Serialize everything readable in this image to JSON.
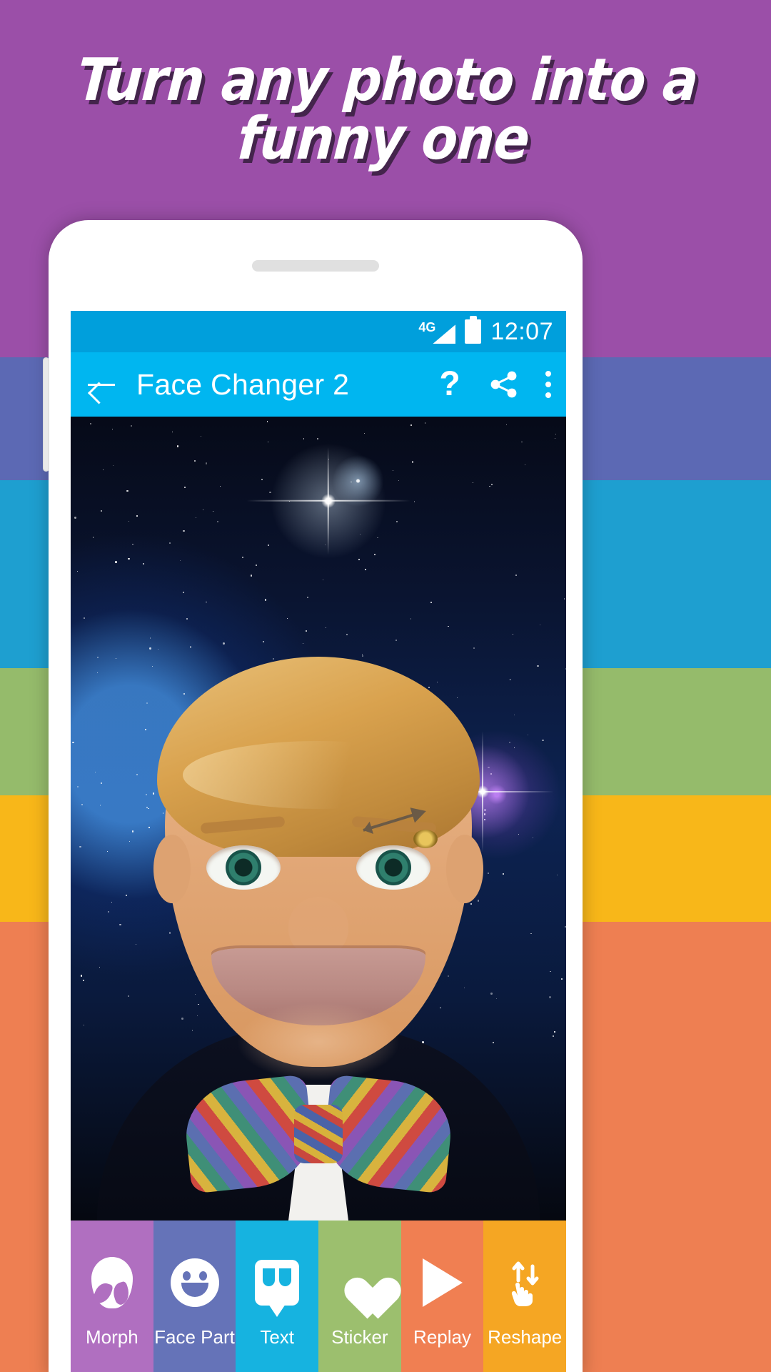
{
  "promo": {
    "headline_line1": "Turn any photo into a",
    "headline_line2": "funny one",
    "background_color": "#9b4fa8",
    "stripe_colors": [
      "#9b4fa8",
      "#5c69b4",
      "#1e9fd0",
      "#95bb6b",
      "#f8b719",
      "#ee7f52"
    ]
  },
  "status_bar": {
    "network_label": "4G",
    "signal_icon": "signal-triangle-icon",
    "battery_icon": "battery-full-icon",
    "time": "12:07",
    "background_color": "#009fdc"
  },
  "app_bar": {
    "back_icon": "back-arrow-icon",
    "title": "Face Changer 2",
    "help_label": "?",
    "share_icon": "share-icon",
    "overflow_icon": "overflow-menu-icon",
    "background_color": "#00b6f0"
  },
  "photo": {
    "subject": "caricature portrait on starry space background",
    "decorations": [
      "arrow-sticker",
      "bee-sticker",
      "bowtie"
    ]
  },
  "toolbar": {
    "tabs": [
      {
        "label": "Morph",
        "icon": "alien-head-icon",
        "color": "#b06fc0"
      },
      {
        "label": "Face Part",
        "icon": "smiley-face-icon",
        "color": "#6573b8"
      },
      {
        "label": "Text",
        "icon": "quote-bubble-icon",
        "color": "#16b3e0"
      },
      {
        "label": "Sticker",
        "icon": "heart-icon",
        "color": "#9cbf6e"
      },
      {
        "label": "Replay",
        "icon": "play-icon",
        "color": "#f07f52"
      },
      {
        "label": "Reshape",
        "icon": "reshape-hand-icon",
        "color": "#f5a623"
      }
    ]
  }
}
